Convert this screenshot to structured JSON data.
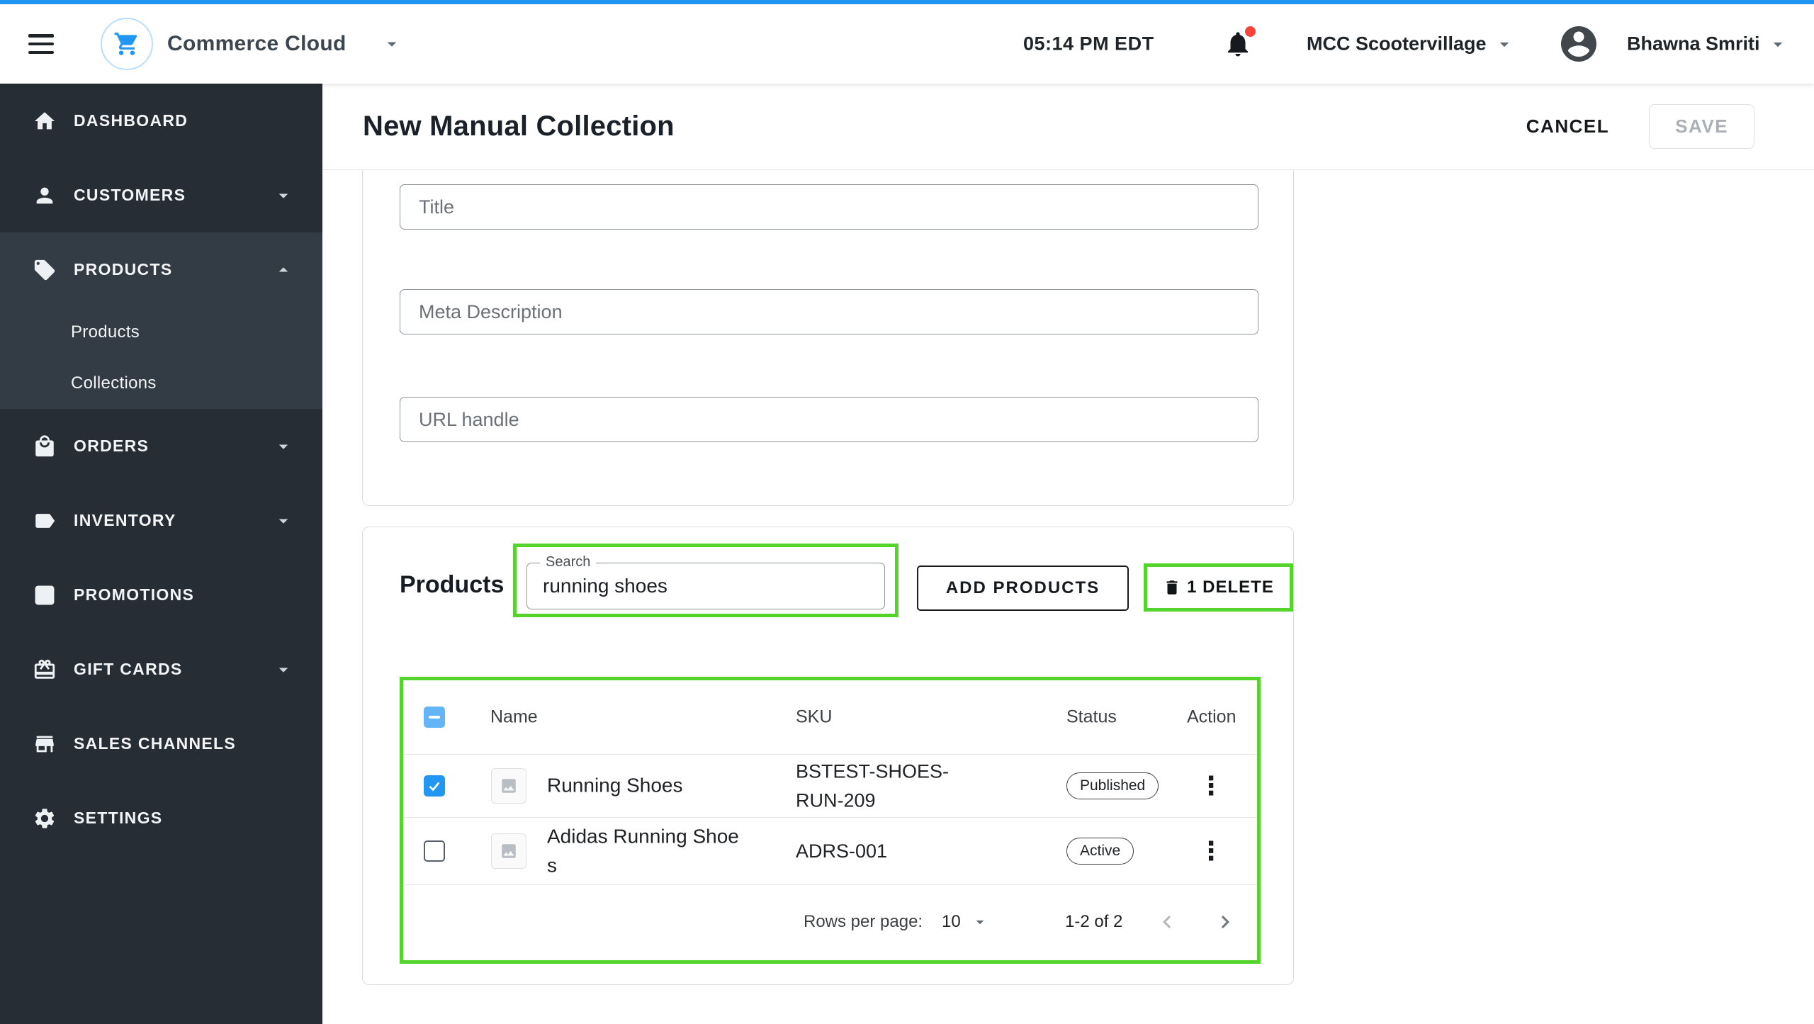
{
  "colors": {
    "accent_blue": "#2196f3",
    "highlight_green": "#55d42c",
    "sidebar_bg": "#262d35",
    "checked_checkbox": "#2196f3",
    "indeterminate_checkbox": "#64b5f6",
    "notification_dot": "#f4443e"
  },
  "topbar": {
    "brand": "Commerce Cloud",
    "time": "05:14 PM EDT",
    "org": "MCC Scootervillage",
    "user": "Bhawna Smriti"
  },
  "sidebar": {
    "items": [
      {
        "label": "DASHBOARD"
      },
      {
        "label": "CUSTOMERS"
      },
      {
        "label": "PRODUCTS",
        "children": [
          {
            "label": "Products"
          },
          {
            "label": "Collections"
          }
        ]
      },
      {
        "label": "ORDERS"
      },
      {
        "label": "INVENTORY"
      },
      {
        "label": "PROMOTIONS"
      },
      {
        "label": "GIFT CARDS"
      },
      {
        "label": "SALES CHANNELS"
      },
      {
        "label": "SETTINGS"
      }
    ]
  },
  "page": {
    "title": "New Manual Collection",
    "cancel_label": "CANCEL",
    "save_label": "SAVE"
  },
  "form": {
    "title_placeholder": "Title",
    "meta_placeholder": "Meta Description",
    "url_placeholder": "URL handle"
  },
  "products": {
    "heading": "Products",
    "search_label": "Search",
    "search_value": "running shoes",
    "add_products_label": "ADD PRODUCTS",
    "delete_label": "1 DELETE",
    "table": {
      "headers": {
        "name": "Name",
        "sku": "SKU",
        "status": "Status",
        "action": "Action"
      },
      "rows": [
        {
          "name": "Running Shoes",
          "sku": "BSTEST-SHOES-RUN-209",
          "status": "Published",
          "checked": true
        },
        {
          "name": "Adidas Running Shoes",
          "sku": "ADRS-001",
          "status": "Active",
          "checked": false
        }
      ],
      "pagination": {
        "rows_per_page_label": "Rows per page:",
        "rows_per_page_value": "10",
        "range_label": "1-2 of 2"
      }
    }
  }
}
